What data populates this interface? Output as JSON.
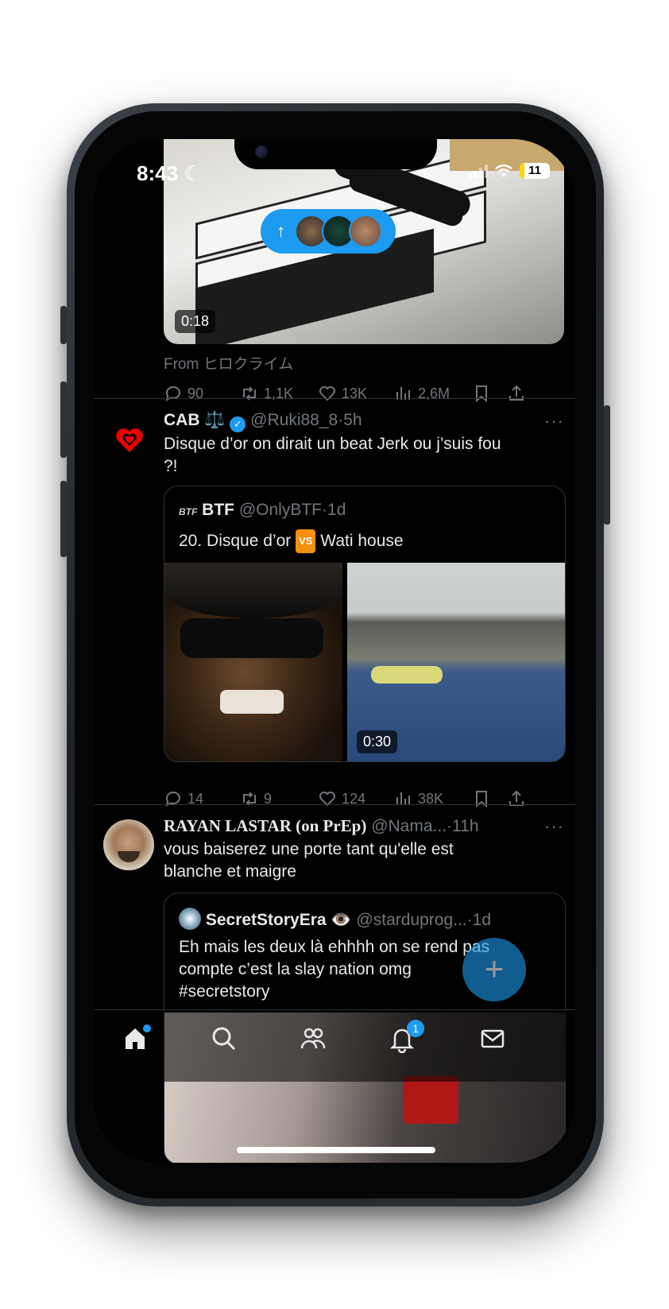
{
  "status_bar": {
    "time": "8:43",
    "battery": "11"
  },
  "feed_pill": {
    "label": ""
  },
  "post1": {
    "video_duration": "0:18",
    "source": "From ヒロクライム",
    "actions": {
      "replies": "90",
      "reposts": "1,1K",
      "likes": "13K",
      "views": "2,6M"
    }
  },
  "post2": {
    "name": "CAB ⚖️",
    "handle": "@Ruki88_8",
    "time": "5h",
    "text": "Disque d’or on dirait un beat Jerk ou j’suis fou ?!",
    "quote": {
      "name": "BTF",
      "handle": "@OnlyBTF",
      "time": "1d",
      "text_before": "20. Disque d’or",
      "vs": "VS",
      "text_after": "Wati house",
      "video_duration": "0:30"
    },
    "actions": {
      "replies": "14",
      "reposts": "9",
      "likes": "124",
      "views": "38K"
    }
  },
  "post3": {
    "name": "RAYAN LASTAR (on PrEp)",
    "handle": "@Nama...",
    "time": "11h",
    "text": "vous baiserez une porte tant qu'elle est blanche et maigre",
    "quote": {
      "name": "SecretStoryEra 👁️",
      "handle": "@starduprog...",
      "time": "1d",
      "text": "Eh mais les deux là ehhhh on se rend pas compte c’est la slay nation omg #secretstory"
    }
  },
  "fab": {
    "label": "+"
  },
  "tabbar": {
    "notifications_badge": "1"
  },
  "colors": {
    "accent": "#1d9bf0",
    "background": "#000000",
    "muted": "#71767b",
    "divider": "#2f3336"
  },
  "icons": [
    "reply-icon",
    "repost-icon",
    "like-icon",
    "views-icon",
    "bookmark-icon",
    "share-icon",
    "home-icon",
    "search-icon",
    "communities-icon",
    "notifications-icon",
    "messages-icon"
  ]
}
